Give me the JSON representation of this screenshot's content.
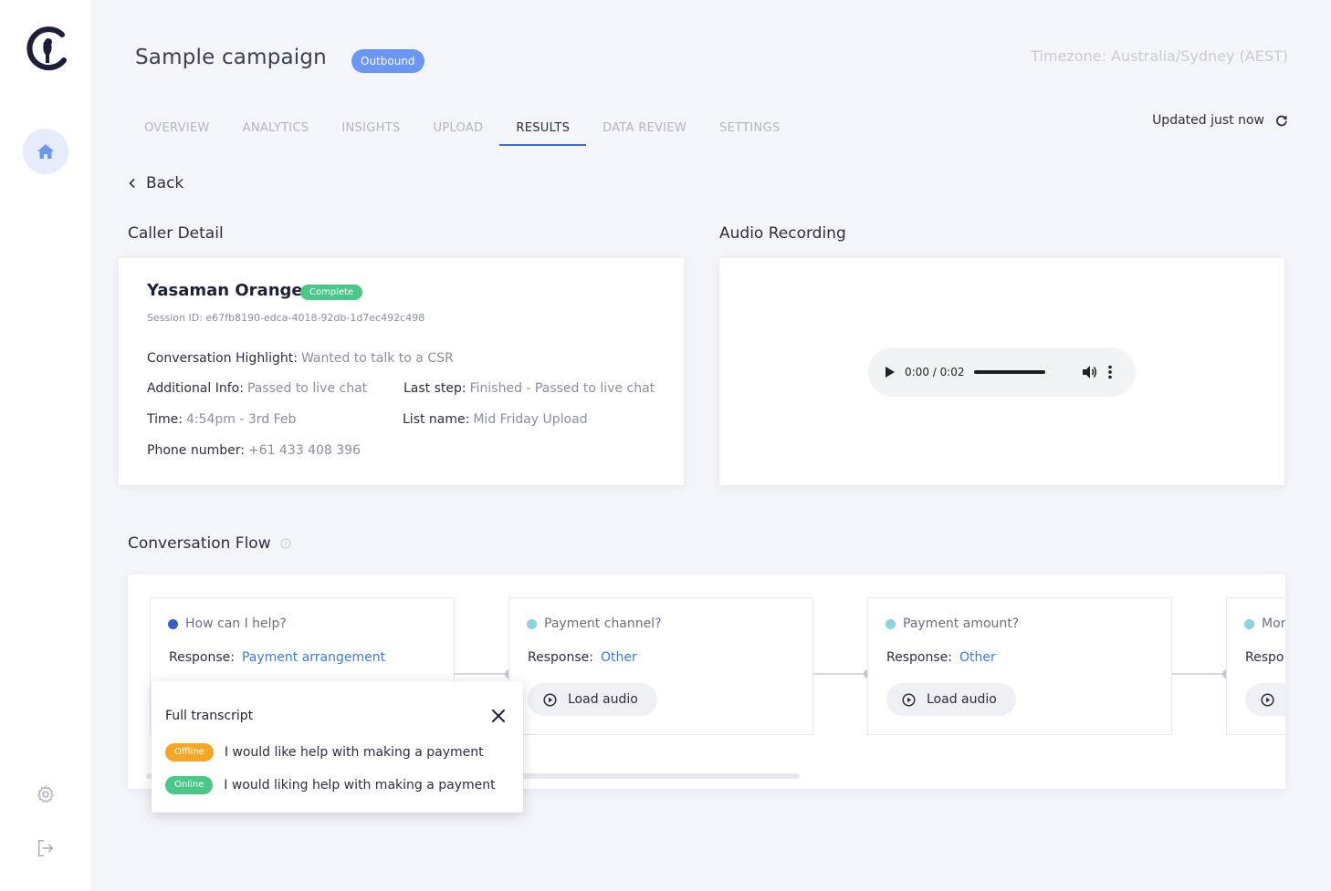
{
  "header": {
    "title": "Sample campaign",
    "badge": "Outbound",
    "timezone": "Timezone: Australia/Sydney (AEST)",
    "updated": "Updated just now"
  },
  "tabs": [
    {
      "label": "OVERVIEW"
    },
    {
      "label": "ANALYTICS"
    },
    {
      "label": "INSIGHTS"
    },
    {
      "label": "UPLOAD"
    },
    {
      "label": "RESULTS",
      "active": true
    },
    {
      "label": "DATA REVIEW"
    },
    {
      "label": "SETTINGS"
    }
  ],
  "back_label": "Back",
  "caller": {
    "section_title": "Caller Detail",
    "name": "Yasaman Orange",
    "status": "Complete",
    "session": "Session ID: e67fb8190-edca-4018-92db-1d7ec492c498",
    "highlight": {
      "label": "Conversation Highlight:",
      "value": "Wanted to talk to a CSR"
    },
    "additional": {
      "label": "Additional Info:",
      "value": "Passed to live chat"
    },
    "last_step": {
      "label": "Last step:",
      "value": "Finished - Passed to live chat"
    },
    "time": {
      "label": "Time:",
      "value": "4:54pm - 3rd Feb"
    },
    "list_name": {
      "label": "List name:",
      "value": "Mid Friday Upload"
    },
    "phone": {
      "label": "Phone number:",
      "value": "+61 433 408 396"
    }
  },
  "audio": {
    "section_title": "Audio Recording",
    "time": "0:00 / 0:02"
  },
  "flow": {
    "section_title": "Conversation Flow",
    "response_label": "Response:",
    "load_audio": "Load audio",
    "nodes": [
      {
        "question": "How can I help?",
        "response": "Payment arrangement",
        "dot": "#3a5bc7"
      },
      {
        "question": "Payment channel?",
        "response": "Other",
        "dot": "#8ad6dc"
      },
      {
        "question": "Payment amount?",
        "response": "Other",
        "dot": "#8ad6dc"
      },
      {
        "question": "Mor",
        "response": "",
        "dot": "#8ad6dc"
      }
    ],
    "partial_response_label": "Respo"
  },
  "transcript": {
    "title": "Full transcript",
    "lines": [
      {
        "badge": "Offline",
        "badge_color": "#f5a623",
        "text": "I would like help with making a payment"
      },
      {
        "badge": "Online",
        "badge_color": "#4cc78a",
        "text": "I would liking help with making a payment"
      }
    ]
  }
}
